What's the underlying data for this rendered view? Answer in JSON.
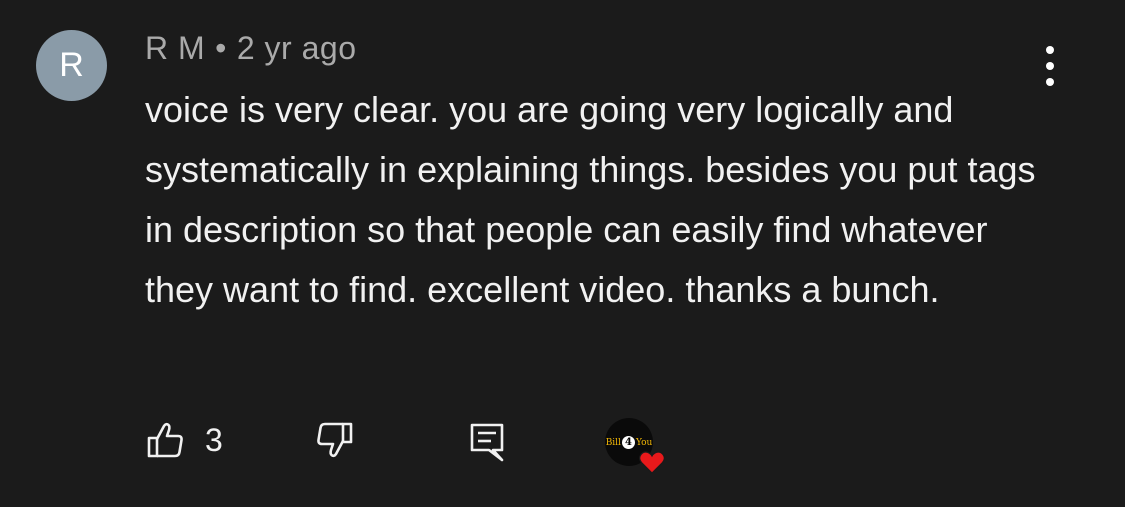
{
  "comment": {
    "avatar_letter": "R",
    "author": "R M",
    "separator": "•",
    "timestamp": "2 yr ago",
    "text": "voice is very clear. you are going very logically and systematically in explaining things. besides you put tags in description so that people can easily find whatever they want to find. excellent video. thanks a bunch."
  },
  "actions": {
    "like_count": "3",
    "like_icon": "thumbs-up-icon",
    "dislike_icon": "thumbs-down-icon",
    "reply_icon": "reply-icon",
    "more_icon": "more-vertical-icon"
  },
  "creator_heart": {
    "logo_left": "Bill",
    "logo_num": "4",
    "logo_right": "You",
    "heart_color": "#e8191b"
  },
  "colors": {
    "background": "#1b1b1b",
    "avatar_bg": "#8a9ba8",
    "meta_text": "#aaaaaa",
    "body_text": "#f1f1f1"
  }
}
